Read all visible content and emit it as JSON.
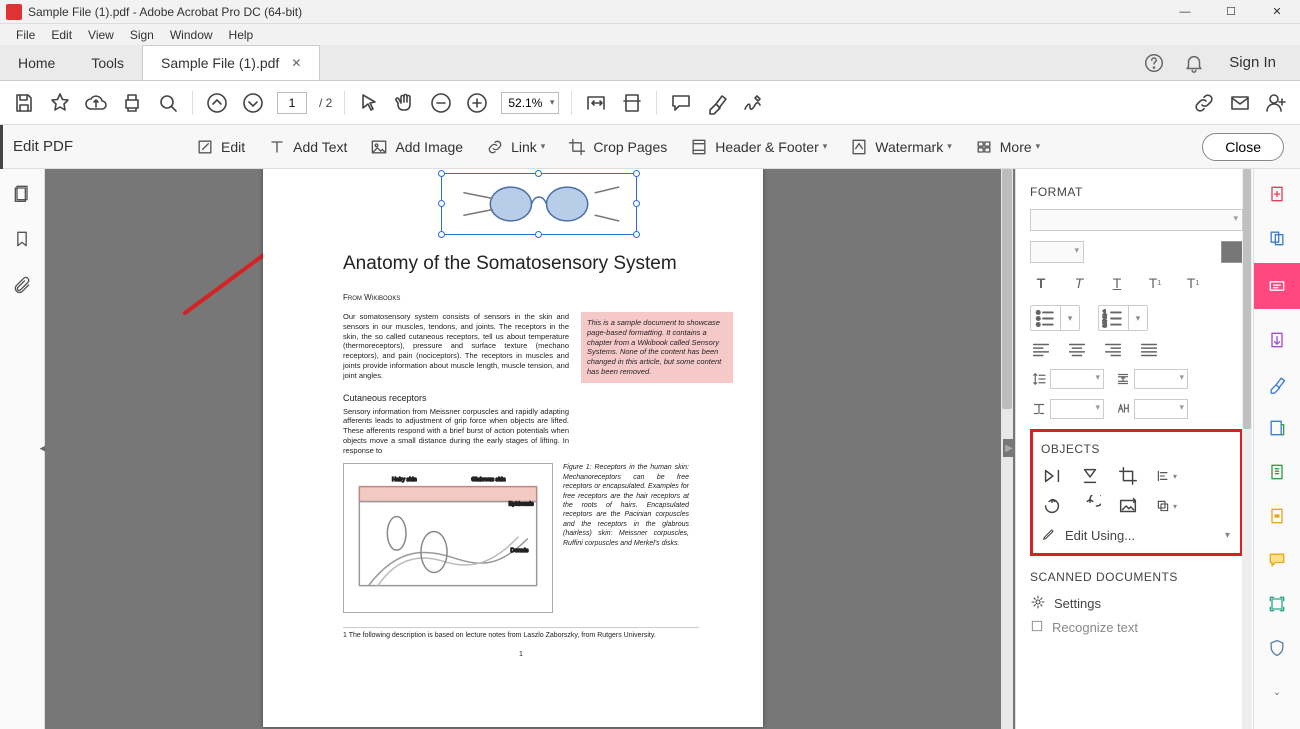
{
  "window": {
    "title": "Sample File (1).pdf - Adobe Acrobat Pro DC (64-bit)"
  },
  "menubar": [
    "File",
    "Edit",
    "View",
    "Sign",
    "Window",
    "Help"
  ],
  "primary_tabs": {
    "home": "Home",
    "tools": "Tools",
    "doc": "Sample File (1).pdf",
    "sign_in": "Sign In"
  },
  "toolbar": {
    "page_current": "1",
    "page_total": "/  2",
    "zoom": "52.1%"
  },
  "edit_toolbar": {
    "title": "Edit PDF",
    "edit": "Edit",
    "add_text": "Add Text",
    "add_image": "Add Image",
    "link": "Link",
    "crop": "Crop Pages",
    "header_footer": "Header & Footer",
    "watermark": "Watermark",
    "more": "More",
    "close": "Close"
  },
  "document": {
    "title": "Anatomy of the Somatosensory System",
    "from": "From Wikibooks",
    "body1": "Our somatosensory system consists of sensors in the skin and sensors in our muscles, tendons, and joints. The receptors in the skin, the so called cutaneous receptors, tell us about temperature (thermoreceptors), pressure and surface texture (mechano receptors), and pain (nociceptors). The receptors in muscles and joints provide information about muscle length, muscle tension, and joint angles.",
    "aside": "This is a sample document to showcase page-based formatting. It contains a chapter from a Wikibook called Sensory Systems. None of the content has been changed in this article, but some content has been removed.",
    "sub1": "Cutaneous receptors",
    "body2": "Sensory information from Meissner corpuscles and rapidly adapting afferents leads to adjustment of grip force when objects are lifted. These afferents respond with a brief burst of action potentials when objects move a small distance during the early stages of lifting. In response to",
    "figcap": "Figure 1: Receptors in the human skin: Mechanoreceptors can be free receptors or encapsulated. Examples for free receptors are the hair receptors at the roots of hairs. Encapsulated receptors are the Pacinian corpuscles and the receptors in the glabrous (hairless) skin: Meissner corpuscles, Ruffini corpuscles and Merkel's disks.",
    "footnote": "1 The following description is based on lecture notes from Laszlo Zaborszky, from Rutgers University.",
    "pageno": "1"
  },
  "right_panel": {
    "format_title": "FORMAT",
    "objects_title": "OBJECTS",
    "edit_using": "Edit Using...",
    "scanned_title": "SCANNED DOCUMENTS",
    "settings": "Settings",
    "recognize": "Recognize text"
  }
}
